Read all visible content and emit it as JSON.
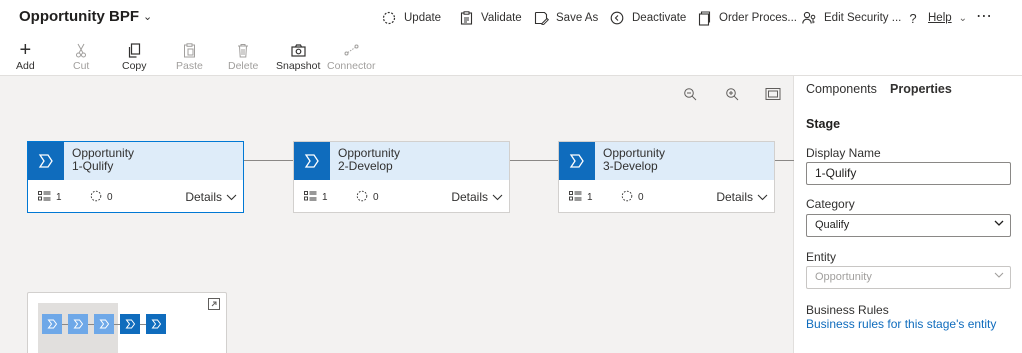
{
  "header": {
    "title": "Opportunity BPF",
    "commands": [
      {
        "label": "Update",
        "icon": "refresh-icon"
      },
      {
        "label": "Validate",
        "icon": "clipboard-check-icon"
      },
      {
        "label": "Save As",
        "icon": "save-as-icon"
      },
      {
        "label": "Deactivate",
        "icon": "deactivate-icon"
      },
      {
        "label": "Order Proces...",
        "icon": "order-process-icon"
      },
      {
        "label": "Edit Security ...",
        "icon": "security-roles-icon"
      },
      {
        "label": "Help",
        "icon": "help-icon"
      },
      {
        "label": "⋯",
        "icon": "more-icon"
      }
    ]
  },
  "ribbon": {
    "add": "Add",
    "cut": "Cut",
    "copy": "Copy",
    "paste": "Paste",
    "delete": "Delete",
    "snapshot": "Snapshot",
    "connector": "Connector"
  },
  "stages": [
    {
      "line1": "Opportunity",
      "line2": "1-Qulify",
      "steps": "1",
      "conditions": "0",
      "details": "Details",
      "selected": true
    },
    {
      "line1": "Opportunity",
      "line2": "2-Develop",
      "steps": "1",
      "conditions": "0",
      "details": "Details",
      "selected": false
    },
    {
      "line1": "Opportunity",
      "line2": "3-Develop",
      "steps": "1",
      "conditions": "0",
      "details": "Details",
      "selected": false
    }
  ],
  "panel": {
    "tabs": {
      "components": "Components",
      "properties": "Properties"
    },
    "section": "Stage",
    "display_name_label": "Display Name",
    "display_name_value": "1-Qulify",
    "category_label": "Category",
    "category_value": "Qualify",
    "entity_label": "Entity",
    "entity_value": "Opportunity",
    "business_rules_label": "Business Rules",
    "business_rules_link": "Business rules for this stage's entity"
  },
  "colors": {
    "accent": "#0f6cbd",
    "stage_header": "#deecf9",
    "canvas": "#f3f2f1"
  }
}
